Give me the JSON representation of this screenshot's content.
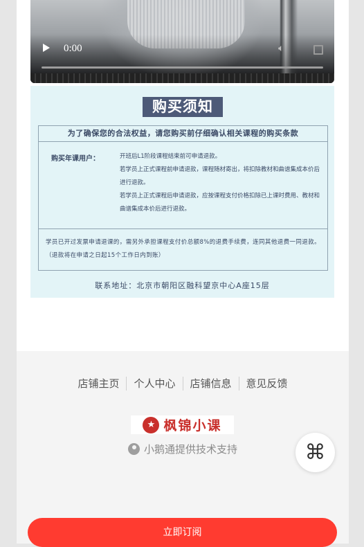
{
  "video": {
    "time": "0:00",
    "play_icon": "play-icon",
    "volume_icon": "volume-icon",
    "fullscreen_icon": "fullscreen-icon"
  },
  "notice": {
    "title": "购买须知",
    "header": "为了确保您的合法权益，请您购买前仔细确认相关课程的购买条款",
    "label": "购买年课用户：",
    "rules": [
      "开班后L1阶段课程结束前可申请退款。",
      "若学员上正式课程前申请退款，课程随材寄出，将扣除教材和曲谱集成本价后进行退款。",
      "若学员上正式课程后申请退款，应按课程支付价格扣除已上课时费用、教材和曲谱集成本价后进行退款。"
    ],
    "bottom": "学员已开过发票申请退课的，需另外承担课程支付价总额8%的退费手续费，连同其他退费一同退款。（退款将在申请之日起15个工作日内到账）",
    "address": "联系地址：北京市朝阳区融科望京中心A座15层"
  },
  "footer": {
    "links": [
      "店铺主页",
      "个人中心",
      "店铺信息",
      "意见反馈"
    ],
    "brand": "枫锦小课",
    "support": "小鹅通提供技术支持"
  },
  "float_menu_icon": "⌘",
  "subscribe": "立即订阅",
  "colors": {
    "accent": "#ff3b30",
    "notice_bg": "#e3f4f7",
    "title_bg": "#4d5a78",
    "brand": "#c9302c"
  }
}
